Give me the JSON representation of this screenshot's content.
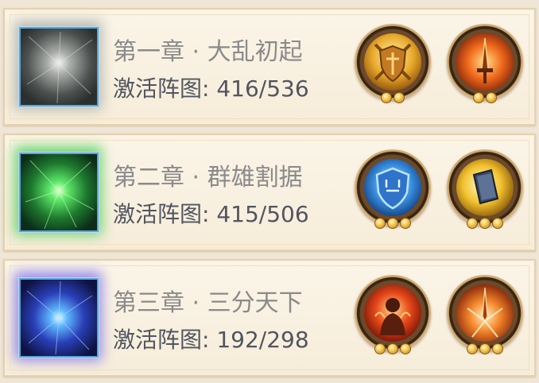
{
  "chapters": [
    {
      "title": "第一章 · 大乱初起",
      "progress_label": "激活阵图:",
      "progress": "416/536",
      "thumb_color": "#8c8f8c",
      "medals": [
        {
          "icon": "golden-shield-swords-icon",
          "stars": 2
        },
        {
          "icon": "flaming-sword-icon",
          "stars": 2
        }
      ]
    },
    {
      "title": "第二章 · 群雄割据",
      "progress_label": "激活阵图:",
      "progress": "415/506",
      "thumb_color": "#39d04a",
      "medals": [
        {
          "icon": "blue-shield-icon",
          "stars": 3
        },
        {
          "icon": "golden-tome-icon",
          "stars": 3
        }
      ]
    },
    {
      "title": "第三章 · 三分天下",
      "progress_label": "激活阵图:",
      "progress": "192/298",
      "thumb_color": "#3b6cff",
      "medals": [
        {
          "icon": "flame-warrior-icon",
          "stars": 3
        },
        {
          "icon": "sword-burst-icon",
          "stars": 3
        }
      ]
    }
  ]
}
